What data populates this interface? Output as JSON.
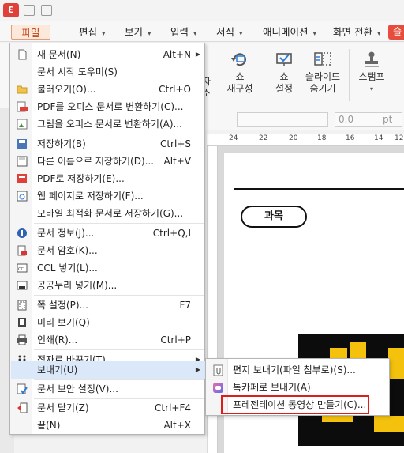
{
  "menubar": {
    "tabs": [
      {
        "label": "파일",
        "has_arrow": false
      },
      {
        "label": "편집",
        "has_arrow": true
      },
      {
        "label": "보기",
        "has_arrow": true
      },
      {
        "label": "입력",
        "has_arrow": true
      },
      {
        "label": "서식",
        "has_arrow": true
      },
      {
        "label": "애니메이션",
        "has_arrow": true
      },
      {
        "label": "화면 전환",
        "has_arrow": true
      }
    ],
    "right_button_label": "슬"
  },
  "ribbon": {
    "partial_left_label_top": "자",
    "partial_left_label_bottom": "소",
    "items": [
      {
        "label": "쇼",
        "label2": "재구성",
        "has_dropdown": true
      },
      {
        "label": "쇼",
        "label2": "설정",
        "has_dropdown": false
      },
      {
        "label": "슬라이드",
        "label2": "숨기기",
        "has_dropdown": false
      },
      {
        "label": "스탬프",
        "label2": "",
        "has_dropdown": true
      }
    ]
  },
  "format_toolbar": {
    "size_value": "0.0",
    "size_unit": "pt"
  },
  "ruler": {
    "labels": [
      "24",
      "22",
      "20",
      "18",
      "16",
      "14",
      "12"
    ]
  },
  "document": {
    "subject_label": "과목"
  },
  "file_menu": {
    "items": [
      {
        "label": "새 문서(N)",
        "shortcut": "Alt+N",
        "submenu": true,
        "icon": "new-document-icon"
      },
      {
        "label": "문서 시작 도우미(S)",
        "shortcut": "",
        "submenu": false,
        "icon": ""
      },
      {
        "label": "불러오기(O)...",
        "shortcut": "Ctrl+O",
        "submenu": false,
        "icon": "open-folder-icon"
      },
      {
        "label": "PDF를 오피스 문서로 변환하기(C)...",
        "shortcut": "",
        "submenu": false,
        "icon": "pdf-convert-icon"
      },
      {
        "label": "그림을 오피스 문서로 변환하기(A)...",
        "shortcut": "",
        "submenu": false,
        "icon": "image-convert-icon"
      },
      {
        "label": "저장하기(B)",
        "shortcut": "Ctrl+S",
        "submenu": false,
        "icon": "save-icon"
      },
      {
        "label": "다른 이름으로 저장하기(D)...",
        "shortcut": "Alt+V",
        "submenu": false,
        "icon": "save-as-icon"
      },
      {
        "label": "PDF로 저장하기(E)...",
        "shortcut": "",
        "submenu": false,
        "icon": "pdf-save-icon"
      },
      {
        "label": "웹 페이지로 저장하기(F)...",
        "shortcut": "",
        "submenu": false,
        "icon": "web-save-icon"
      },
      {
        "label": "모바일 최적화 문서로 저장하기(G)...",
        "shortcut": "",
        "submenu": false,
        "icon": ""
      },
      {
        "label": "문서 정보(J)...",
        "shortcut": "Ctrl+Q,I",
        "submenu": false,
        "icon": "info-icon"
      },
      {
        "label": "문서 암호(K)...",
        "shortcut": "",
        "submenu": false,
        "icon": "lock-icon"
      },
      {
        "label": "CCL 넣기(L)...",
        "shortcut": "",
        "submenu": false,
        "icon": "ccl-icon"
      },
      {
        "label": "공공누리 넣기(M)...",
        "shortcut": "",
        "submenu": false,
        "icon": "open-license-icon"
      },
      {
        "label": "쪽 설정(P)...",
        "shortcut": "F7",
        "submenu": false,
        "icon": "page-setup-icon"
      },
      {
        "label": "미리 보기(Q)",
        "shortcut": "",
        "submenu": false,
        "icon": "preview-icon"
      },
      {
        "label": "인쇄(R)...",
        "shortcut": "Ctrl+P",
        "submenu": false,
        "icon": "print-icon"
      },
      {
        "label": "점자로 바꾸기(T)",
        "shortcut": "",
        "submenu": true,
        "icon": "braille-icon"
      },
      {
        "label": "보내기(U)",
        "shortcut": "",
        "submenu": true,
        "icon": "",
        "highlighted": true
      },
      {
        "label": "문서 보안 설정(V)...",
        "shortcut": "",
        "submenu": false,
        "icon": "security-settings-icon"
      },
      {
        "label": "문서 닫기(Z)",
        "shortcut": "Ctrl+F4",
        "submenu": false,
        "icon": "close-document-icon"
      },
      {
        "label": "끝(N)",
        "shortcut": "Alt+X",
        "submenu": false,
        "icon": ""
      }
    ]
  },
  "send_submenu": {
    "items": [
      {
        "label": "편지 보내기(파일 첨부로)(S)...",
        "icon": "mail-attach-icon"
      },
      {
        "label": "톡카페로 보내기(A)",
        "icon": "talkcafe-icon"
      },
      {
        "label": "프레젠테이션 동영상 만들기(C)...",
        "icon": "",
        "outlined": true
      }
    ]
  },
  "colors": {
    "accent": "#e74c3c",
    "highlight": "#dbe8f9",
    "outline": "#e01b1b",
    "file_tab_bg": "#fde8dc"
  }
}
